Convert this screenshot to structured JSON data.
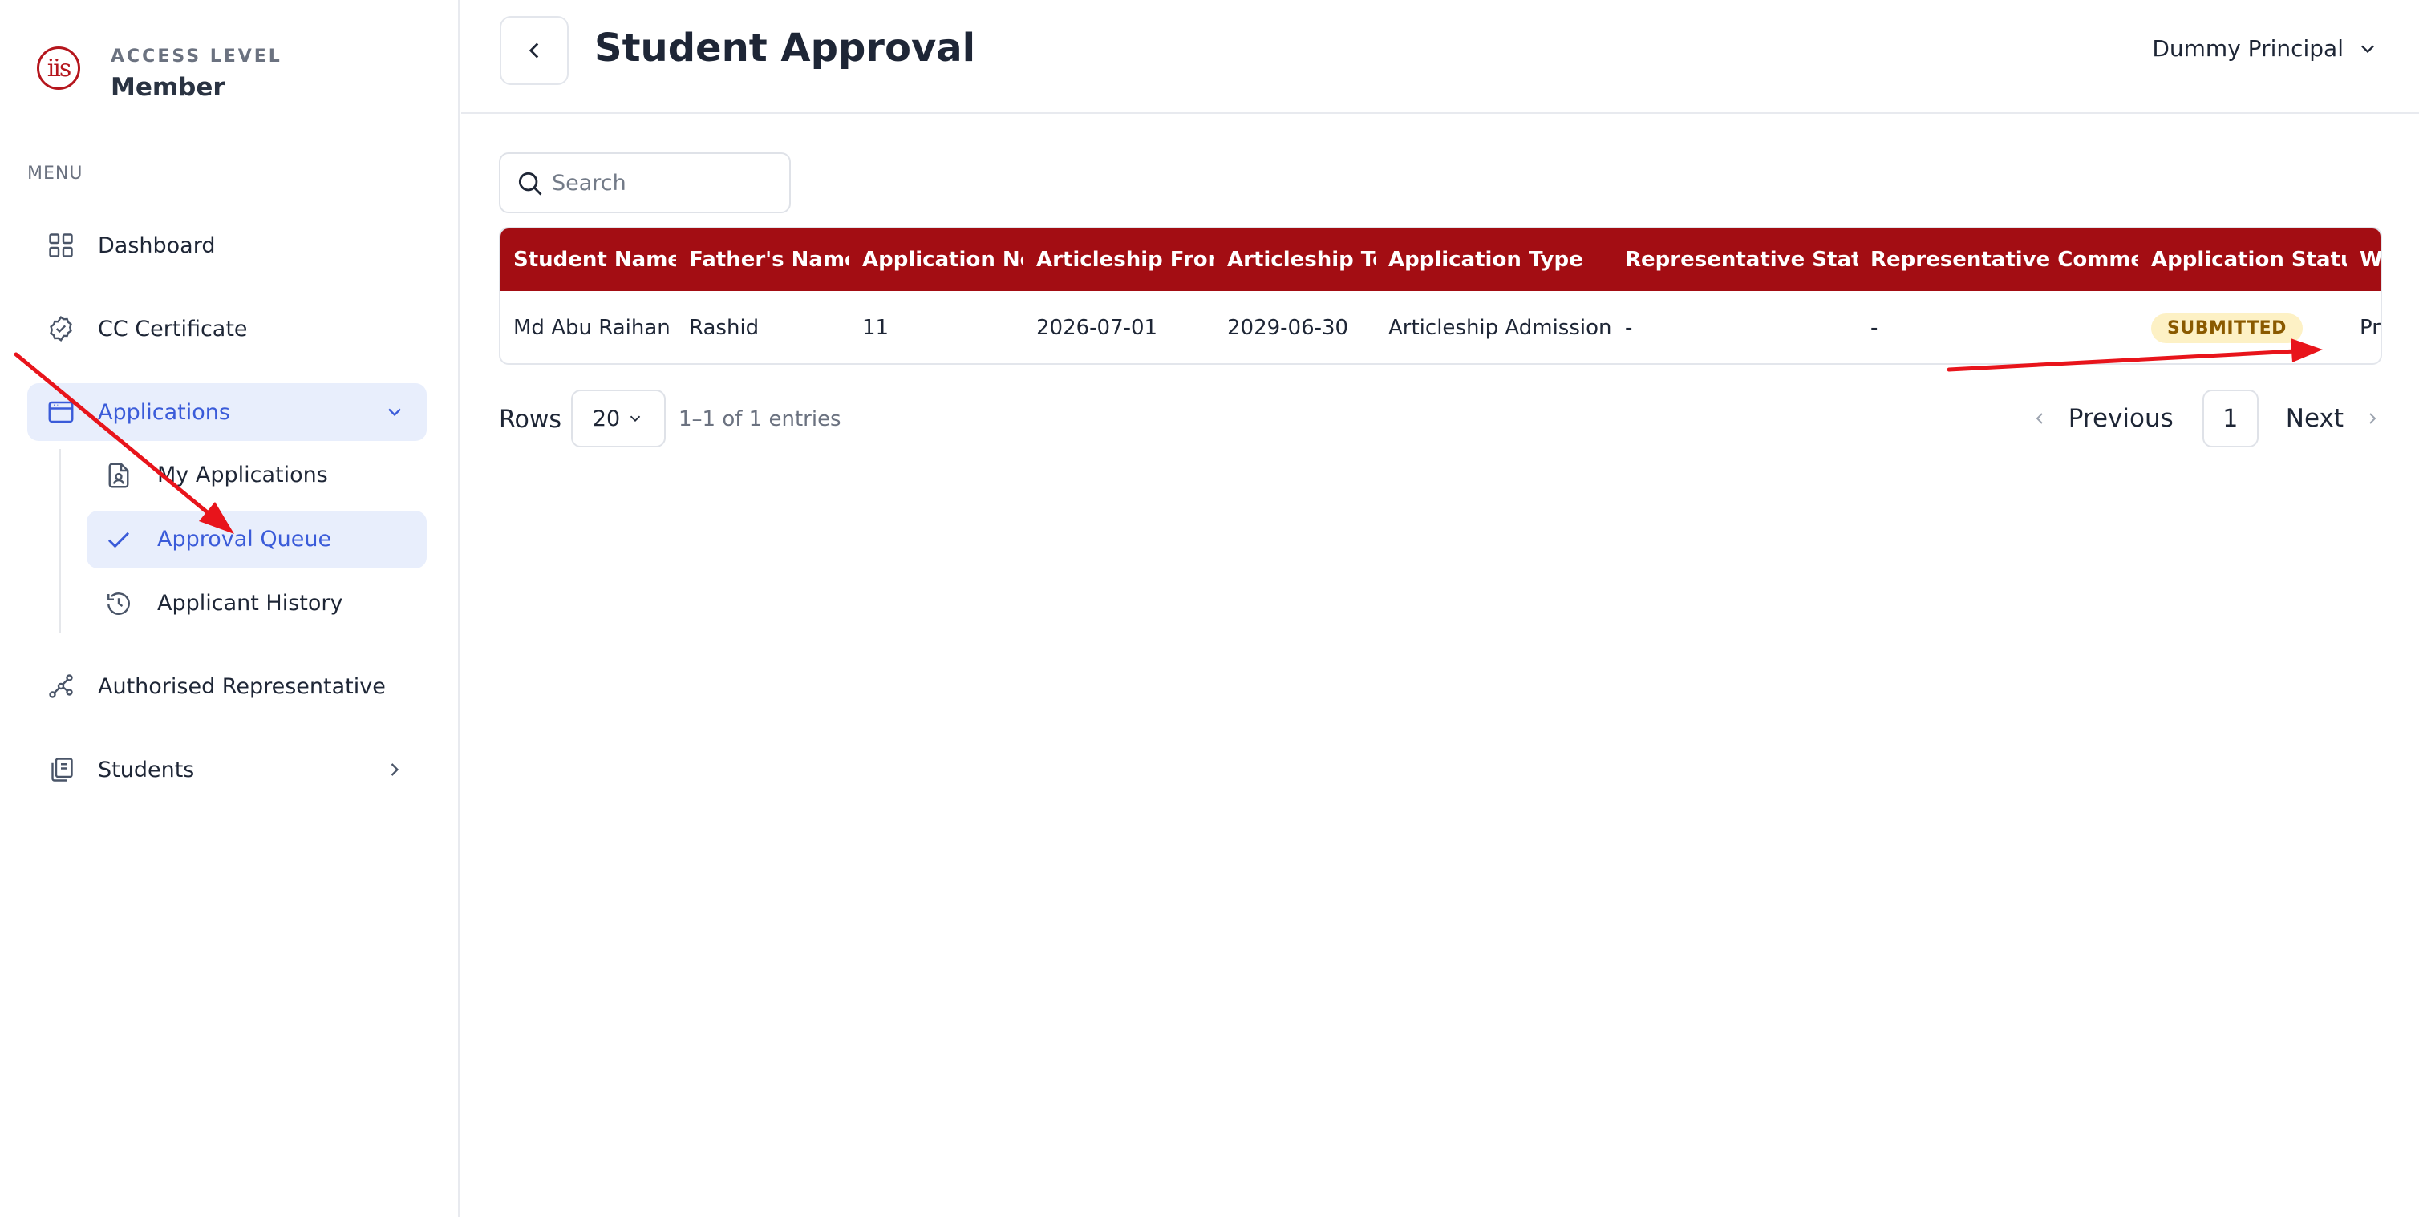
{
  "brand": {
    "logo_text": "iis",
    "access_label": "ACCESS LEVEL",
    "access_value": "Member"
  },
  "sidebar": {
    "menu_label": "MENU",
    "items": [
      {
        "label": "Dashboard",
        "icon": "grid-icon"
      },
      {
        "label": "CC Certificate",
        "icon": "badge-check-icon"
      },
      {
        "label": "Applications",
        "icon": "browser-window-icon",
        "active": true
      },
      {
        "label": "Authorised Representative",
        "icon": "network-icon"
      },
      {
        "label": "Students",
        "icon": "book-copy-icon"
      }
    ],
    "sub_items": [
      {
        "label": "My Applications",
        "icon": "file-user-icon"
      },
      {
        "label": "Approval Queue",
        "icon": "check-icon",
        "active": true
      },
      {
        "label": "Applicant History",
        "icon": "history-icon"
      }
    ]
  },
  "header": {
    "title": "Student Approval",
    "user": "Dummy Principal"
  },
  "search": {
    "placeholder": "Search"
  },
  "table": {
    "columns": [
      "Student Name",
      "Father's Name",
      "Application No",
      "Articleship From",
      "Articleship To",
      "Application Type",
      "Representative Status",
      "Representative Comment",
      "Application Status",
      "Work Status"
    ],
    "rows": [
      [
        "Md Abu Raihan",
        "Rashid",
        "11",
        "2026-07-01",
        "2029-06-30",
        "Articleship Admission",
        "-",
        "-",
        "SUBMITTED",
        "Pr"
      ]
    ]
  },
  "pagination": {
    "rows_label": "Rows",
    "rows_value": "20",
    "entries": "1–1 of 1 entries",
    "prev": "Previous",
    "page": "1",
    "next": "Next"
  },
  "colors": {
    "accent": "#3a5bd9",
    "table_header": "#a30d13",
    "badge_bg": "#fdf1c5",
    "annotation": "#e8141b"
  }
}
